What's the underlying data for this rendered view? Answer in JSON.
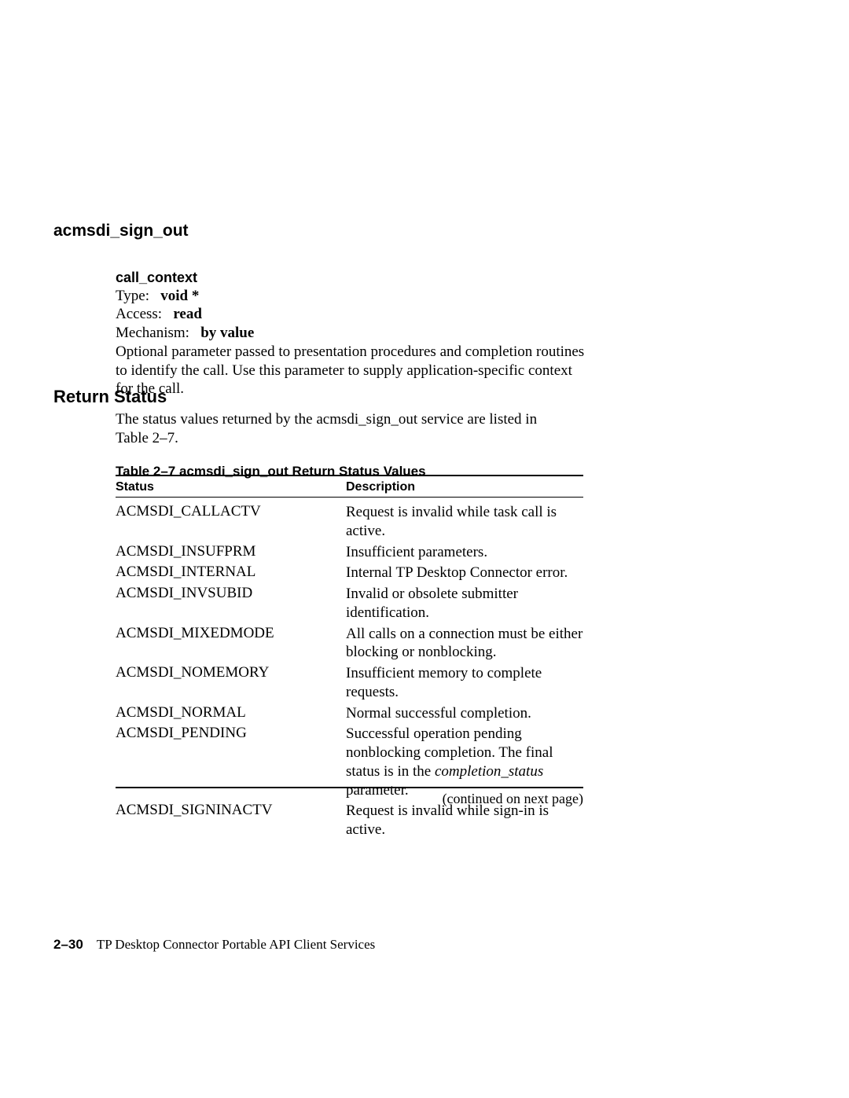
{
  "running_head": "acmsdi_sign_out",
  "param": {
    "name": "call_context",
    "type_label": "Type:",
    "type_value": "void *",
    "access_label": "Access:",
    "access_value": "read",
    "mechanism_label": "Mechanism:",
    "mechanism_value": "by value",
    "desc_line1": "Optional parameter passed to presentation procedures and completion routines",
    "desc_line2": "to identify the call.  Use this parameter to supply application-specific context",
    "desc_line3": "for the call."
  },
  "return_status_heading": "Return Status",
  "return_status_para_l1": "The status values returned by the acmsdi_sign_out service are listed in",
  "return_status_para_l2": "Table 2–7.",
  "table": {
    "caption": "Table 2–7   acmsdi_sign_out Return Status Values",
    "head_status": "Status",
    "head_desc": "Description",
    "rows": [
      {
        "status": "ACMSDI_CALLACTV",
        "desc": "Request is invalid while task call is active."
      },
      {
        "status": "ACMSDI_INSUFPRM",
        "desc": "Insufficient parameters."
      },
      {
        "status": "ACMSDI_INTERNAL",
        "desc": "Internal TP Desktop Connector error."
      },
      {
        "status": "ACMSDI_INVSUBID",
        "desc": "Invalid or obsolete submitter identification."
      },
      {
        "status": "ACMSDI_MIXEDMODE",
        "desc": "All calls on a connection must be either blocking or nonblocking."
      },
      {
        "status": "ACMSDI_NOMEMORY",
        "desc": "Insufficient memory to complete requests."
      },
      {
        "status": "ACMSDI_NORMAL",
        "desc": "Normal successful completion."
      },
      {
        "status": "ACMSDI_PENDING",
        "desc_pre": "Successful operation pending nonblocking completion.  The final status is in the ",
        "desc_italic": "completion_status",
        "desc_post": " parameter."
      },
      {
        "status": "ACMSDI_SIGNINACTV",
        "desc": "Request is invalid while sign-in is active."
      }
    ],
    "continued": "(continued on next page)"
  },
  "footer": {
    "page_number": "2–30",
    "title": "TP Desktop Connector Portable API Client Services"
  }
}
